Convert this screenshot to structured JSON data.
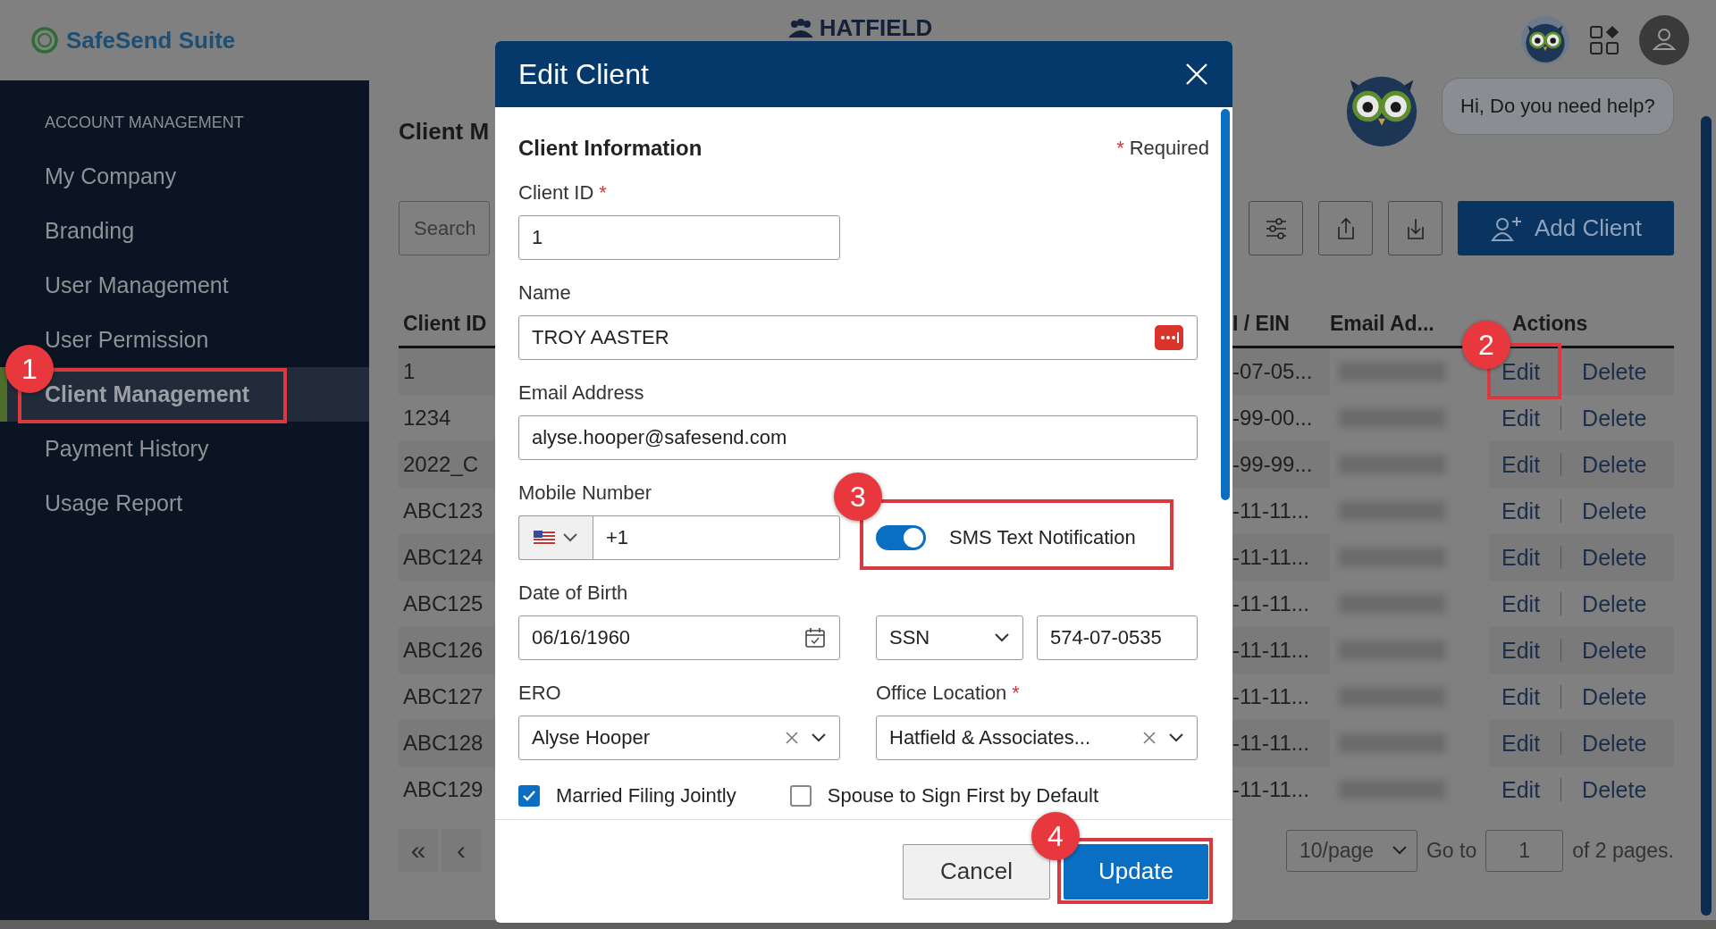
{
  "header": {
    "brand": "SafeSend Suite",
    "company": "HATFIELD"
  },
  "sidebar": {
    "heading": "ACCOUNT MANAGEMENT",
    "items": [
      {
        "label": "My Company",
        "selected": false
      },
      {
        "label": "Branding",
        "selected": false
      },
      {
        "label": "User Management",
        "selected": false
      },
      {
        "label": "User Permission",
        "selected": false
      },
      {
        "label": "Client Management",
        "selected": true
      },
      {
        "label": "Payment History",
        "selected": false
      },
      {
        "label": "Usage Report",
        "selected": false
      }
    ]
  },
  "page": {
    "title": "Client M",
    "search": {
      "placeholder": "Search"
    },
    "add_button": "Add Client"
  },
  "table": {
    "columns": [
      "Client ID",
      "I / EIN",
      "Email Ad...",
      "Actions"
    ],
    "rows": [
      {
        "client_id": "1",
        "ssn_ein": "-07-05...",
        "email_blurred": true,
        "edit": "Edit",
        "delete": "Delete"
      },
      {
        "client_id": "1234",
        "ssn_ein": "-99-00...",
        "email_blurred": true,
        "edit": "Edit",
        "delete": "Delete"
      },
      {
        "client_id": "2022_C",
        "ssn_ein": "-99-99...",
        "email_blurred": true,
        "edit": "Edit",
        "delete": "Delete"
      },
      {
        "client_id": "ABC123",
        "ssn_ein": "-11-11...",
        "email_blurred": true,
        "edit": "Edit",
        "delete": "Delete"
      },
      {
        "client_id": "ABC124",
        "ssn_ein": "-11-11...",
        "email_blurred": true,
        "edit": "Edit",
        "delete": "Delete"
      },
      {
        "client_id": "ABC125",
        "ssn_ein": "-11-11...",
        "email_blurred": true,
        "edit": "Edit",
        "delete": "Delete"
      },
      {
        "client_id": "ABC126",
        "ssn_ein": "-11-11...",
        "email_blurred": true,
        "edit": "Edit",
        "delete": "Delete"
      },
      {
        "client_id": "ABC127",
        "ssn_ein": "-11-11...",
        "email_blurred": true,
        "edit": "Edit",
        "delete": "Delete"
      },
      {
        "client_id": "ABC128",
        "ssn_ein": "-11-11...",
        "email_blurred": true,
        "edit": "Edit",
        "delete": "Delete"
      },
      {
        "client_id": "ABC129",
        "ssn_ein": "-11-11...",
        "email_blurred": true,
        "edit": "Edit",
        "delete": "Delete"
      }
    ]
  },
  "pagination": {
    "first": "«",
    "prev": "‹",
    "page_size": "10/page",
    "goto_label": "Go to",
    "goto_value": "1",
    "pages_text": "of 2 pages."
  },
  "help": {
    "message": "Hi, Do you need help?"
  },
  "modal": {
    "title": "Edit Client",
    "section": "Client Information",
    "required_note": {
      "mark": "*",
      "text": "Required"
    },
    "client_id": {
      "label": "Client ID",
      "required_mark": "*",
      "value": "1"
    },
    "name": {
      "label": "Name",
      "value": "TROY AASTER"
    },
    "email": {
      "label": "Email Address",
      "value": "alyse.hooper@safesend.com"
    },
    "mobile": {
      "label": "Mobile Number",
      "value": "+1"
    },
    "sms": {
      "label": "SMS Text Notification",
      "on": true
    },
    "dob": {
      "label": "Date of Birth",
      "value": "06/16/1960"
    },
    "id_type": {
      "value": "SSN"
    },
    "id_number": {
      "value": "574-07-0535"
    },
    "ero": {
      "label": "ERO",
      "value": "Alyse Hooper"
    },
    "office": {
      "label": "Office Location",
      "required_mark": "*",
      "value": "Hatfield & Associates..."
    },
    "checkboxes": [
      {
        "label": "Married Filing Jointly",
        "checked": true
      },
      {
        "label": "Spouse to Sign First by Default",
        "checked": false
      }
    ],
    "buttons": [
      {
        "label": "Cancel",
        "kind": "secondary"
      },
      {
        "label": "Update",
        "kind": "primary"
      }
    ]
  },
  "annotations": [
    {
      "number": "1"
    },
    {
      "number": "2"
    },
    {
      "number": "3"
    },
    {
      "number": "4"
    }
  ]
}
